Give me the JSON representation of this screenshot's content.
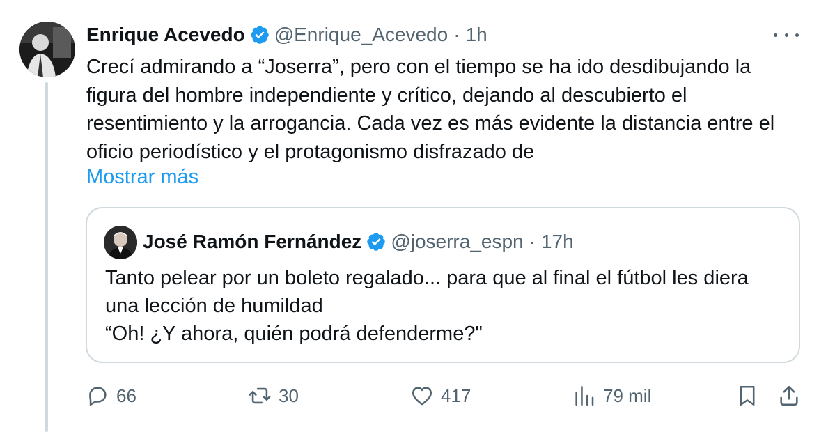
{
  "tweet": {
    "author_name": "Enrique Acevedo",
    "handle": "@Enrique_Acevedo",
    "separator": "·",
    "time": "1h",
    "text": "Crecí admirando a “Joserra”, pero con el tiempo se ha ido desdibujando la figura del hombre independiente y crítico, dejando al descubierto el resentimiento y la arrogancia. Cada vez es más evidente la distancia entre el oficio periodístico y el protagonismo disfrazado de",
    "show_more_label": "Mostrar más"
  },
  "quote": {
    "author_name": "José Ramón Fernández",
    "handle": "@joserra_espn",
    "separator": "·",
    "time": "17h",
    "lines": [
      "Tanto pelear por un boleto regalado... para que al final el fútbol les diera",
      "una lección de humildad",
      "“Oh! ¿Y ahora, quién podrá defenderme?\""
    ]
  },
  "actions": {
    "replies": "66",
    "retweets": "30",
    "likes": "417",
    "views": "79 mil"
  },
  "icons": {
    "verified": "verified-badge-icon",
    "more": "more-options-icon",
    "reply": "reply-icon",
    "retweet": "retweet-icon",
    "like": "heart-icon",
    "views": "views-chart-icon",
    "bookmark": "bookmark-icon",
    "share": "share-icon"
  },
  "colors": {
    "accent": "#1d9bf0",
    "text": "#0f1419",
    "secondary": "#536471",
    "border": "#cfd9de"
  }
}
